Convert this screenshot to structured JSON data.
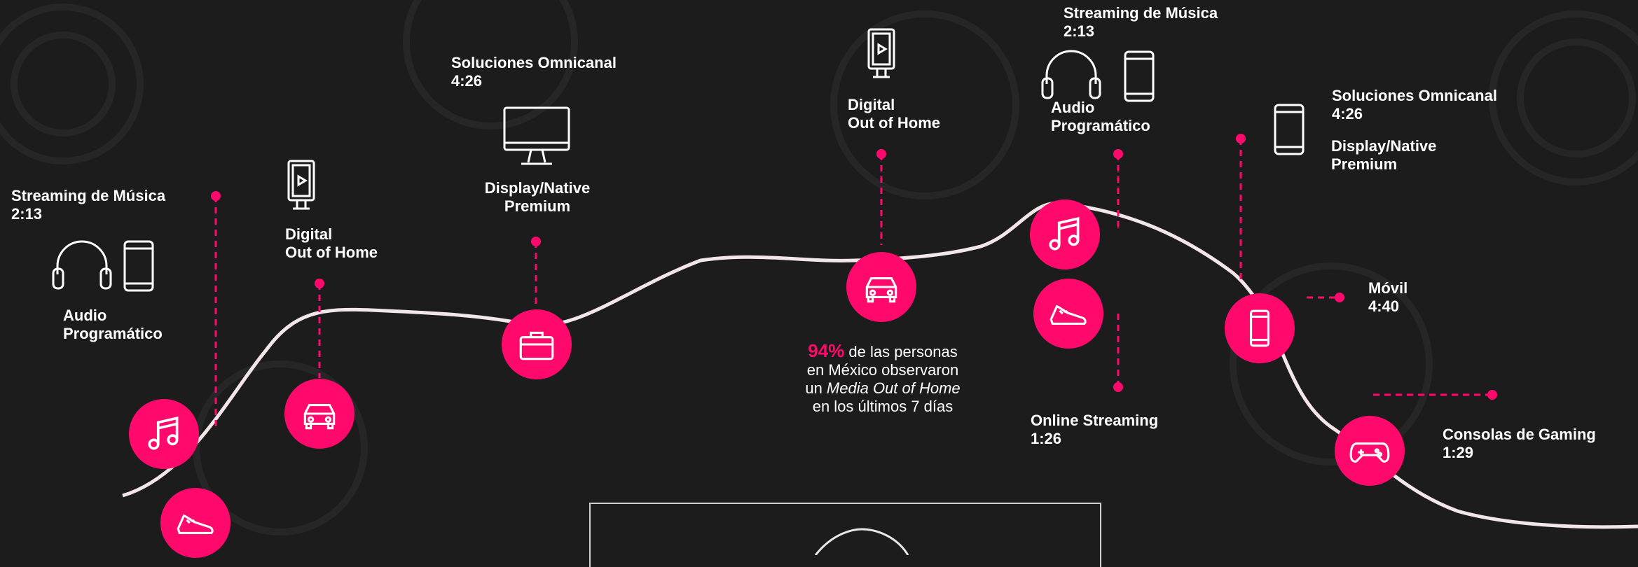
{
  "colors": {
    "background": "#1c1c1c",
    "accent": "#ff0a6c",
    "curve": "#f3e6e8",
    "text": "#ffffff"
  },
  "labels": {
    "l1": {
      "line1": "Streaming de Música",
      "line2": "2:13"
    },
    "l2": {
      "line1": "Audio",
      "line2": "Programático"
    },
    "l3": {
      "line1": "Digital",
      "line2": "Out of Home"
    },
    "l4": {
      "line1": "Soluciones Omnicanal",
      "line2": "4:26"
    },
    "l5": {
      "line1": "Display/Native",
      "line2": "Premium"
    },
    "l6": {
      "line1": "Digital",
      "line2": "Out of Home"
    },
    "l7": {
      "line1": "Streaming de Música",
      "line2": "2:13"
    },
    "l8": {
      "line1": "Audio",
      "line2": "Programático"
    },
    "l9": {
      "line1": "Online Streaming",
      "line2": "1:26"
    },
    "l10": {
      "line1": "Soluciones Omnicanal",
      "line2": "4:26"
    },
    "l11": {
      "line1": "Display/Native",
      "line2": "Premium"
    },
    "l12": {
      "line1": "Móvil",
      "line2": "4:40"
    },
    "l13": {
      "line1": "Consolas de Gaming",
      "line2": "1:29"
    }
  },
  "stat": {
    "percent": "94%",
    "line1_rest": " de las personas",
    "line2": "en México observaron",
    "line3_pre": "un ",
    "line3_italic": "Media Out of Home",
    "line4": "en los últimos 7 días"
  },
  "icons": [
    "music-note-icon",
    "sneaker-icon",
    "car-icon",
    "briefcase-icon",
    "car-icon",
    "music-note-icon",
    "sneaker-icon",
    "smartphone-icon",
    "gamepad-icon",
    "headphones-icon",
    "smartphone-icon",
    "digital-signage-icon",
    "monitor-icon"
  ]
}
